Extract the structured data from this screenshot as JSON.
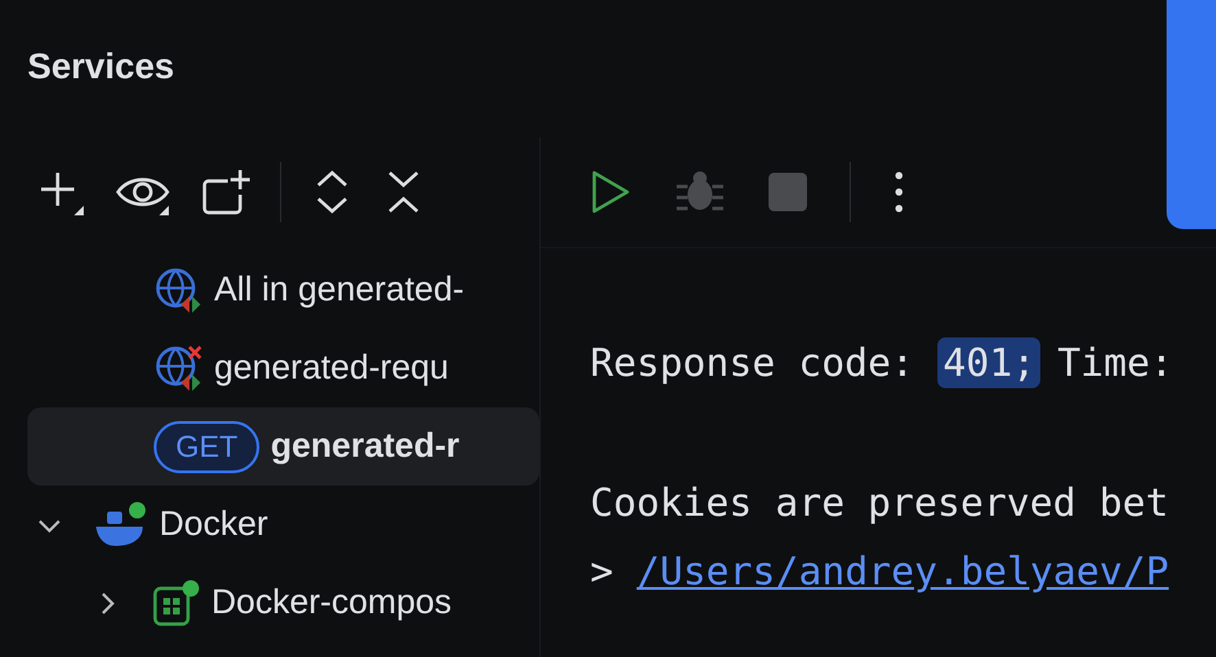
{
  "panel": {
    "title": "Services"
  },
  "tree": [
    {
      "kind": "folder-run",
      "label": "All in generated-",
      "selected": false
    },
    {
      "kind": "folder-failed",
      "label": "generated-requ",
      "selected": false
    },
    {
      "kind": "get",
      "method": "GET",
      "label": "generated-r",
      "selected": true
    },
    {
      "kind": "docker",
      "label": "Docker",
      "expanded": true,
      "children": [
        {
          "kind": "compose",
          "label": "Docker-compos",
          "expanded": false
        }
      ]
    }
  ],
  "output": {
    "label": "Response code:",
    "code": "401;",
    "rest": "Time:",
    "note": "Cookies are preserved bet",
    "prompt": ">",
    "link": "/Users/andrey.belyaev/P"
  }
}
